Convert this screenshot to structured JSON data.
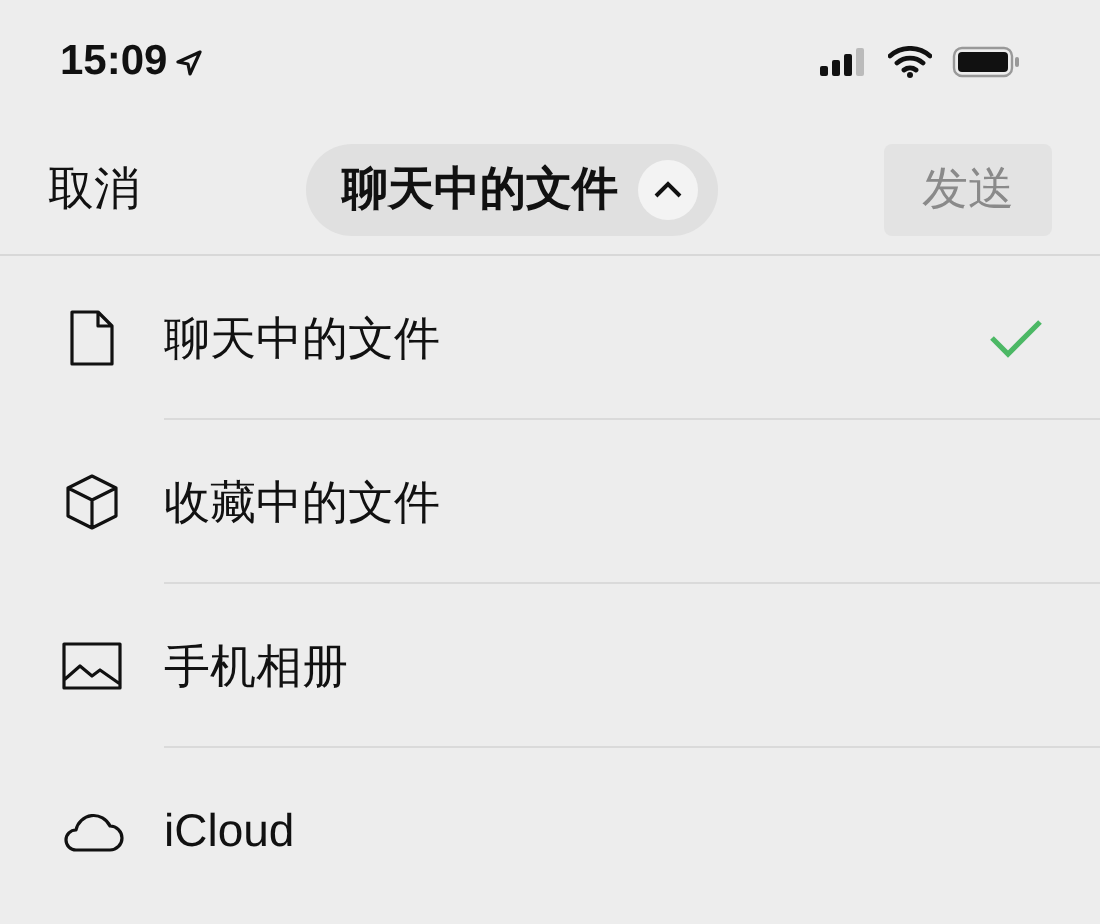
{
  "status_bar": {
    "time": "15:09"
  },
  "nav": {
    "cancel": "取消",
    "title": "聊天中的文件",
    "title_expanded": true,
    "send": {
      "label": "发送",
      "disabled": true
    }
  },
  "items": [
    {
      "kind": "document",
      "label": "聊天中的文件",
      "selected": true
    },
    {
      "kind": "cube",
      "label": "收藏中的文件",
      "selected": false
    },
    {
      "kind": "image",
      "label": "手机相册",
      "selected": false
    },
    {
      "kind": "cloud",
      "label": "iCloud",
      "selected": false
    }
  ]
}
